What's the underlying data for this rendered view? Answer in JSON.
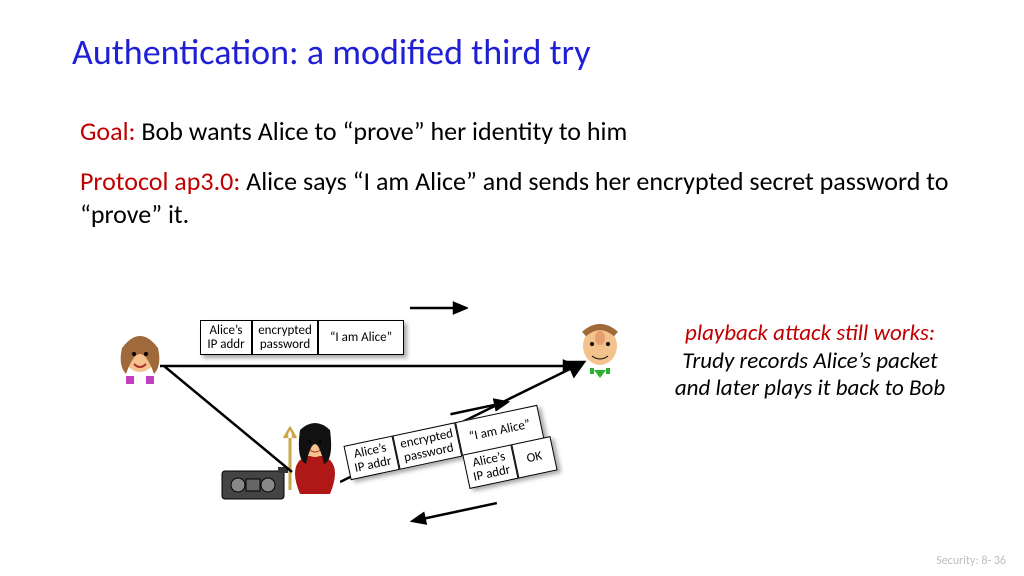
{
  "title": "Authentication: a modified third try",
  "goal_label": "Goal:",
  "goal_text": " Bob wants Alice to “prove” her identity to him",
  "proto_label": "Protocol ap3.0:",
  "proto_text": " Alice says “I am Alice” and sends her encrypted secret password to “prove” it.",
  "packet1": {
    "c1": "Alice’s\nIP addr",
    "c2": "encrypted\npassword",
    "c3": "“I am Alice”"
  },
  "packet2": {
    "c1": "Alice’s\nIP addr",
    "c2": "encrypted\npassword",
    "c3": "“I am Alice”"
  },
  "packet3": {
    "c1": "Alice’s\nIP addr",
    "c2": "OK"
  },
  "note_red": "playback attack still works:",
  "note_rest": " Trudy records Alice’s packet\nand later plays it back to Bob",
  "footer": "Security: 8- 36"
}
